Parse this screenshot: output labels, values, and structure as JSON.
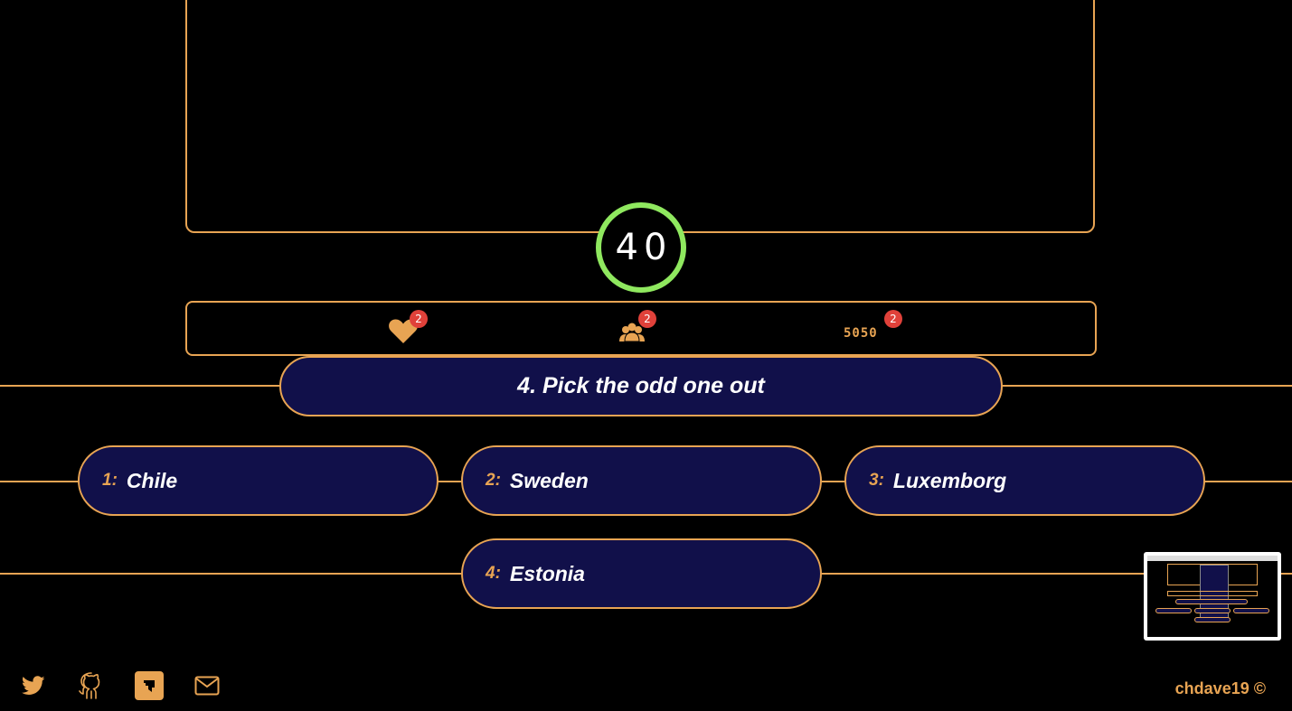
{
  "timer": {
    "value": "40"
  },
  "lifelines": {
    "heart": {
      "count": "2",
      "icon": "heart-icon"
    },
    "audience": {
      "count": "2",
      "icon": "audience-icon"
    },
    "fifty_fifty": {
      "label": "5050",
      "count": "2"
    }
  },
  "question": {
    "text": "4. Pick the odd one out"
  },
  "answers": [
    {
      "number": "1:",
      "text": "Chile"
    },
    {
      "number": "2:",
      "text": "Sweden"
    },
    {
      "number": "3:",
      "text": "Luxemborg"
    },
    {
      "number": "4:",
      "text": "Estonia"
    }
  ],
  "footer": {
    "social": [
      "twitter-icon",
      "github-icon",
      "dev-icon",
      "mail-icon"
    ],
    "credit": "chdave19 ©"
  },
  "colors": {
    "accent": "#e8a453",
    "pill_bg": "#11104a",
    "timer_ring": "#8fe85f",
    "badge": "#e0413a",
    "background": "#000000"
  }
}
